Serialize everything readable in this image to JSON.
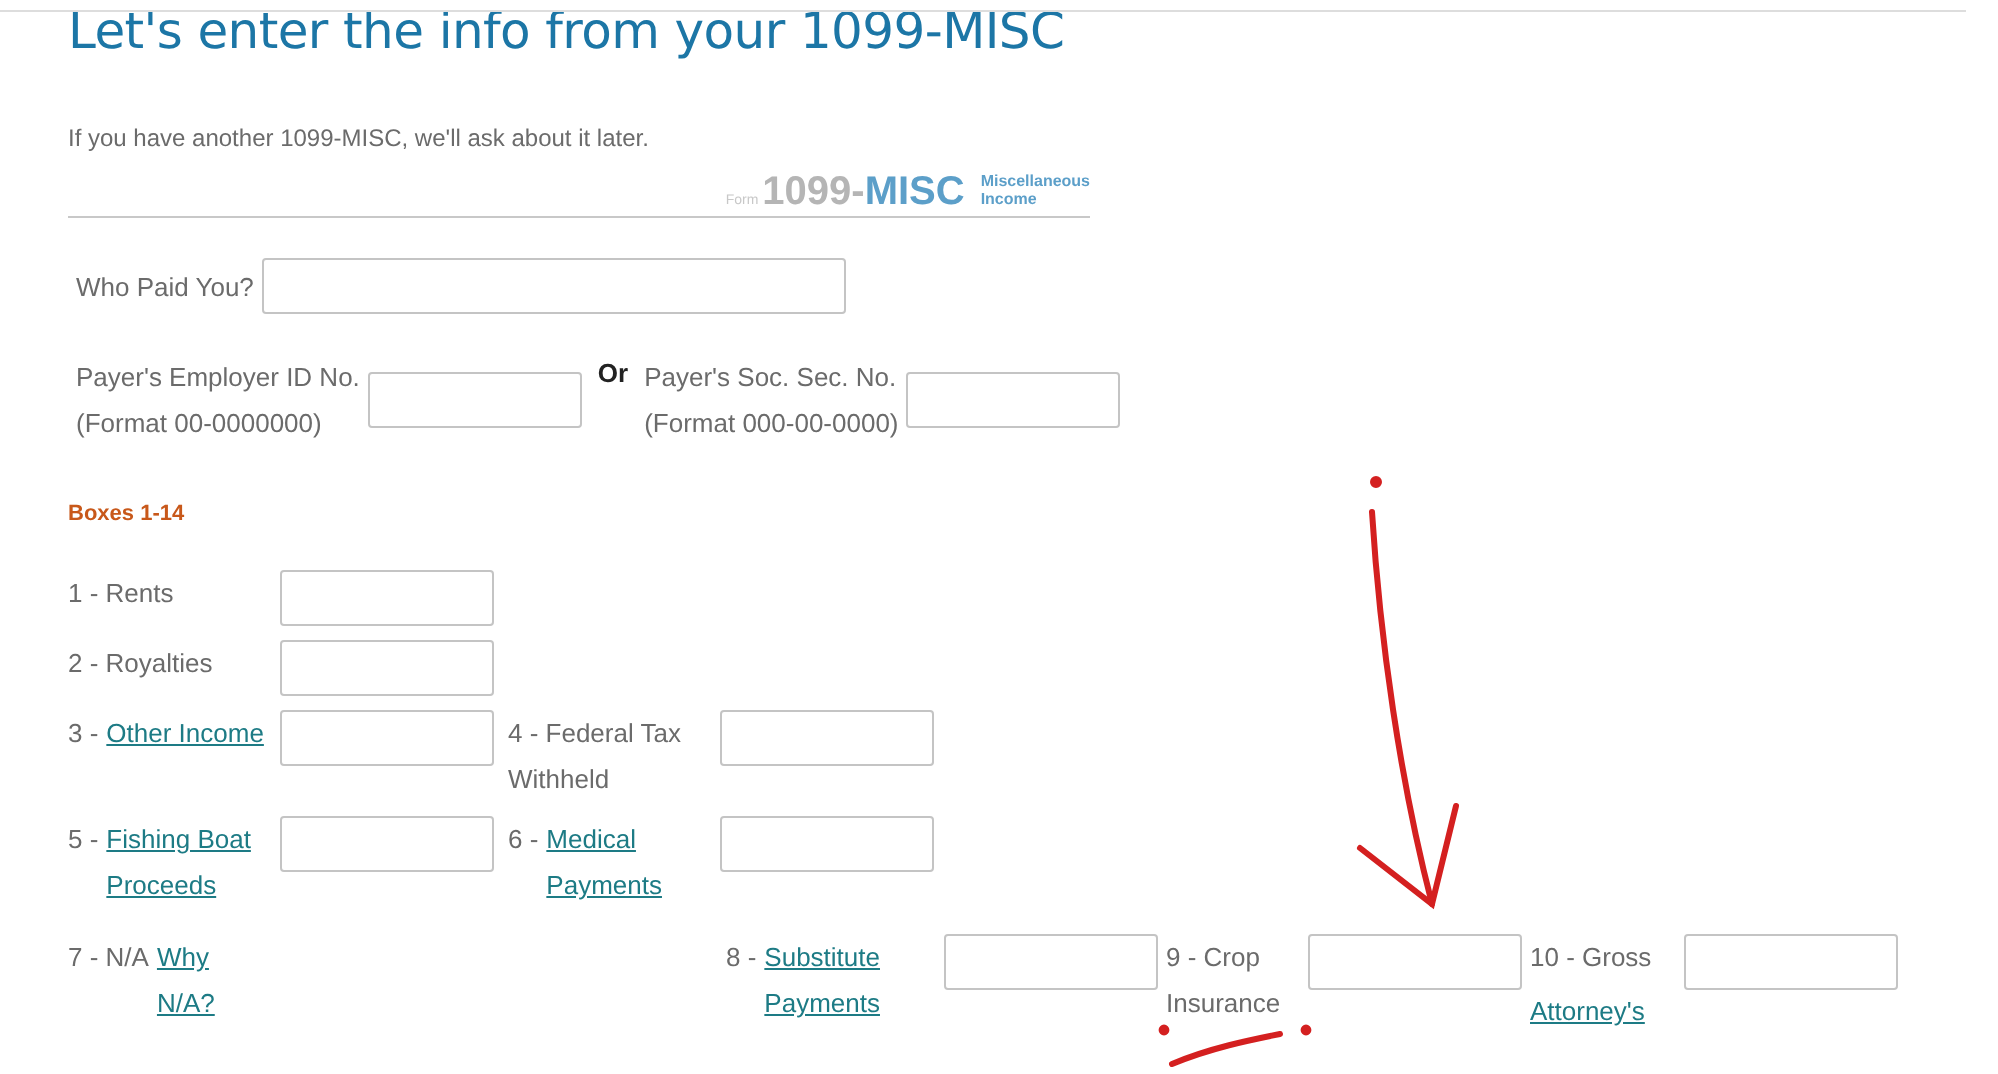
{
  "title": "Let's enter the info from your 1099-MISC",
  "intro": "If you have another 1099-MISC, we'll ask about it later.",
  "form_logo": {
    "prefix": "Form",
    "number": "1099-",
    "code": "MISC",
    "caption": [
      "Miscellaneous",
      "Income"
    ]
  },
  "payer_name": {
    "label": "Who Paid You?"
  },
  "payer_ids": [
    {
      "label": [
        "Payer's Employer ID No.",
        "(Format 00-0000000)"
      ]
    },
    {
      "label": [
        "Payer's Soc. Sec. No.",
        "(Format 000-00-0000)"
      ]
    }
  ],
  "or_text": "Or",
  "section_heading": "Boxes 1-14",
  "box_rows": [
    [
      {
        "label": "1 - Rents",
        "input": true
      }
    ],
    [
      {
        "label": "2 - Royalties",
        "input": true
      }
    ],
    [
      {
        "label": "3 - ",
        "link": "Other Income",
        "input": true
      },
      {
        "label": "4 - Federal Tax Withheld",
        "input": true
      }
    ],
    [
      {
        "label": "5 - ",
        "link": "Fishing Boat Proceeds",
        "input": true
      },
      {
        "label": "6 - ",
        "link": "Medical Payments",
        "input": true
      }
    ],
    [
      {
        "label": "7 - N/A ",
        "link": "Why N/A?",
        "input": false
      },
      {
        "label": "8 - ",
        "link": "Substitute Payments",
        "input": true
      },
      {
        "label": "9 - Crop Insurance",
        "input": true
      },
      {
        "label": "10 - Gross ",
        "link": "Attorney's",
        "input": true
      }
    ]
  ]
}
